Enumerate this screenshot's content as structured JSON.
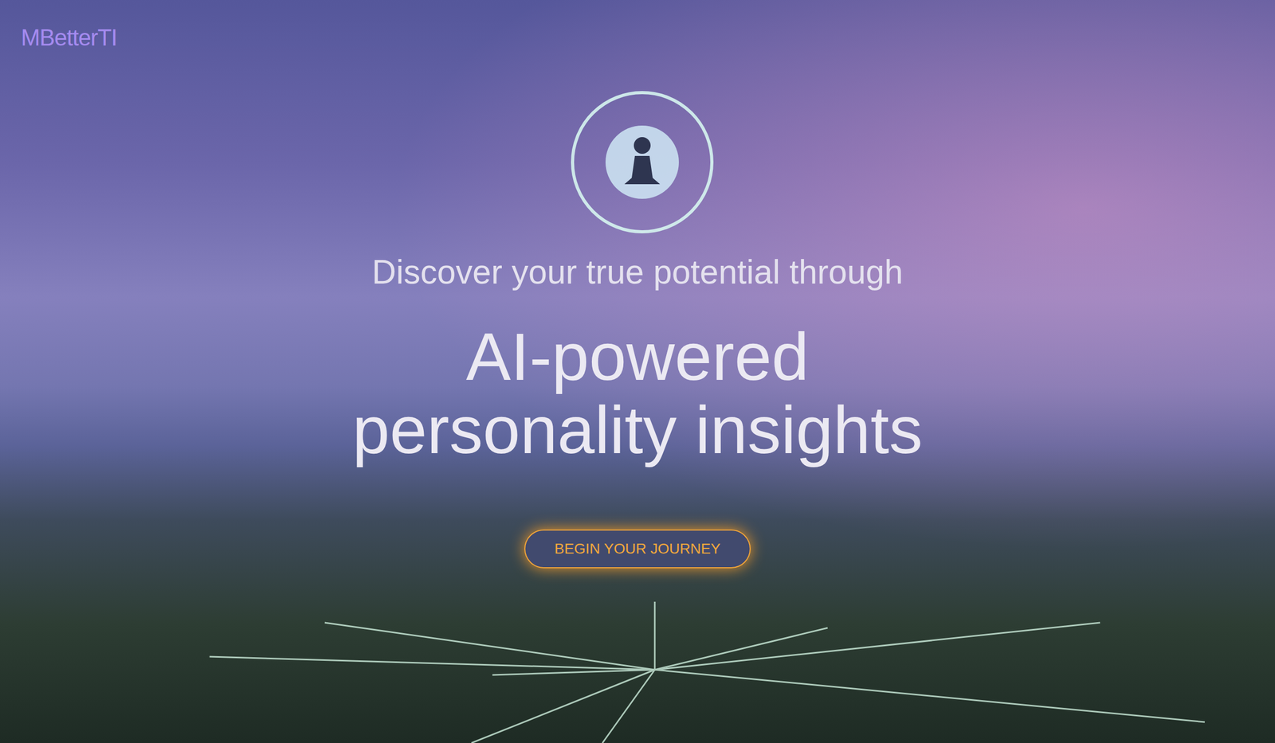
{
  "header": {
    "logo": "MBetterTI"
  },
  "hero": {
    "subtitle": "Discover your true potential through",
    "headline": [
      "AI-powered",
      "personality insights"
    ],
    "cta": "BEGIN YOUR JOURNEY"
  }
}
